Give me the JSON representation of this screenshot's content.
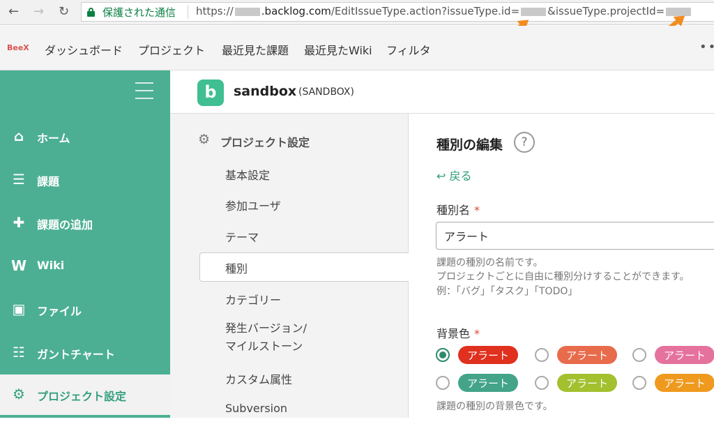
{
  "browser": {
    "secure_label": "保護された通信",
    "url_scheme": "https://",
    "url_domain": ".backlog.com",
    "url_path": "/EditIssueType.action?issueType.id=",
    "url_param2": "&issueType.projectId=",
    "accent_arrow_color": "#f28c1e"
  },
  "appbar": {
    "logo_text": "BeeX",
    "menu": [
      "ダッシュボード",
      "プロジェクト",
      "最近見た課題",
      "最近見たWiki",
      "フィルタ"
    ],
    "more_label": "•••"
  },
  "sidebar": {
    "color": "#4caf93",
    "items": [
      {
        "label": "ホーム",
        "icon": "home-icon",
        "glyph": "⌂"
      },
      {
        "label": "課題",
        "icon": "list-icon",
        "glyph": "☰"
      },
      {
        "label": "課題の追加",
        "icon": "plus-icon",
        "glyph": "✚"
      },
      {
        "label": "Wiki",
        "icon": "wiki-icon",
        "glyph": "W"
      },
      {
        "label": "ファイル",
        "icon": "file-icon",
        "glyph": "▣"
      },
      {
        "label": "ガントチャート",
        "icon": "gantt-icon",
        "glyph": "☷"
      },
      {
        "label": "プロジェクト設定",
        "icon": "gear-icon",
        "glyph": "⚙"
      }
    ]
  },
  "project": {
    "logo_letter": "b",
    "name": "sandbox",
    "key": "(SANDBOX)"
  },
  "settings": {
    "title": "プロジェクト設定",
    "items": [
      "基本設定",
      "参加ユーザ",
      "テーマ",
      "種別",
      "カテゴリー",
      "発生バージョン/\nマイルストーン",
      "カスタム属性",
      "Subversion"
    ],
    "active_index": 3
  },
  "form": {
    "title": "種別の編集",
    "help_label": "?",
    "back_label": "戻る",
    "name_label": "種別名",
    "required_mark": "*",
    "name_value": "アラート",
    "name_hints": [
      "課題の種別の名前です。",
      "プロジェクトごとに自由に種別分けすることができます。",
      "例：「バグ」「タスク」「TODO」"
    ],
    "color_label": "背景色",
    "color_options": [
      {
        "label": "アラート",
        "color": "#e0301e",
        "checked": true
      },
      {
        "label": "アラート",
        "color": "#e86b4c",
        "checked": false
      },
      {
        "label": "アラート",
        "color": "#e5729d",
        "checked": false
      },
      {
        "label": "アラート",
        "color": "#43a48a",
        "checked": false
      },
      {
        "label": "アラート",
        "color": "#a3c02f",
        "checked": false
      },
      {
        "label": "アラート",
        "color": "#ef9a1f",
        "checked": false
      }
    ],
    "color_hint": "課題の種別の背景色です。"
  }
}
